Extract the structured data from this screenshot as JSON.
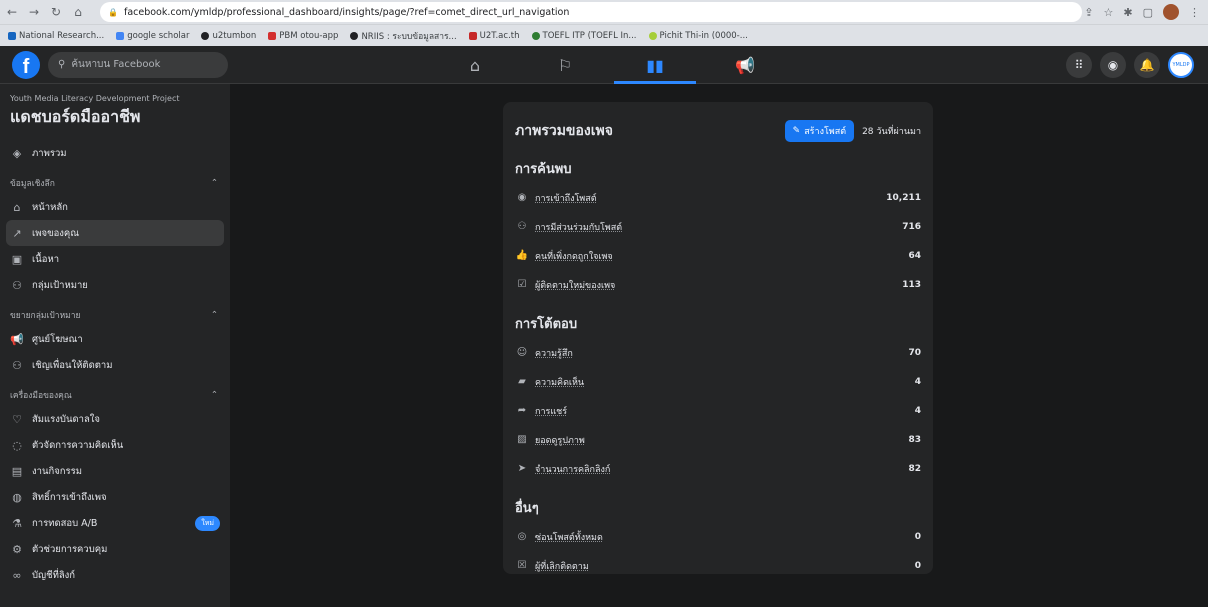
{
  "browser": {
    "url": "facebook.com/ymldp/professional_dashboard/insights/page/?ref=comet_direct_url_navigation",
    "bookmarks": [
      {
        "label": "National Research...",
        "color": "#1565c0"
      },
      {
        "label": "google scholar",
        "color": "#4285f4"
      },
      {
        "label": "u2tumbon",
        "color": "#202124"
      },
      {
        "label": "PBM otou-app",
        "color": "#d32f2f"
      },
      {
        "label": "NRIIS : ระบบข้อมูลสาร...",
        "color": "#202124"
      },
      {
        "label": "U2T.ac.th",
        "color": "#c62828"
      },
      {
        "label": "TOEFL ITP (TOEFL In...",
        "color": "#2e7d32"
      },
      {
        "label": "Pichit Thi-in (0000-...",
        "color": "#a6ce39"
      }
    ]
  },
  "fb": {
    "logo": "f",
    "search_placeholder": "ค้นหาบน Facebook",
    "avatar_text": "YMLDP"
  },
  "sidebar": {
    "project": "Youth Media Literacy Development Project",
    "title": "แดชบอร์ดมืออาชีพ",
    "overview": "ภาพรวม",
    "insights_section": "ข้อมูลเชิงลึก",
    "insights_items": [
      "หน้าหลัก",
      "เพจของคุณ",
      "เนื้อหา",
      "กลุ่มเป้าหมาย"
    ],
    "audience_section": "ขยายกลุ่มเป้าหมาย",
    "audience_items": [
      "ศูนย์โฆษณา",
      "เชิญเพื่อนให้ติดตาม"
    ],
    "tools_section": "เครื่องมือของคุณ",
    "tools_items": [
      "สัมแรงบันดาลใจ",
      "ตัวจัดการความคิดเห็น",
      "งานกิจกรรม",
      "สิทธิ์การเข้าถึงเพจ",
      "การทดสอบ A/B",
      "ตัวช่วยการควบคุม",
      "บัญชีที่ลิงก์"
    ],
    "new_badge": "ใหม่"
  },
  "card": {
    "title": "ภาพรวมของเพจ",
    "create_button": "สร้างโพสต์",
    "period": "28 วันที่ผ่านมา",
    "discovery": {
      "title": "การค้นพบ",
      "rows": [
        {
          "label": "การเข้าถึงโพสต์",
          "value": "10,211"
        },
        {
          "label": "การมีส่วนร่วมกับโพสต์",
          "value": "716"
        },
        {
          "label": "คนที่เพิ่งกดถูกใจเพจ",
          "value": "64"
        },
        {
          "label": "ผู้ติดตามใหม่ของเพจ",
          "value": "113"
        }
      ]
    },
    "interactions": {
      "title": "การโต้ตอบ",
      "rows": [
        {
          "label": "ความรู้สึก",
          "value": "70"
        },
        {
          "label": "ความคิดเห็น",
          "value": "4"
        },
        {
          "label": "การแชร์",
          "value": "4"
        },
        {
          "label": "ยอดดูรูปภาพ",
          "value": "83"
        },
        {
          "label": "จำนวนการคลิกลิงก์",
          "value": "82"
        }
      ]
    },
    "other": {
      "title": "อื่นๆ",
      "rows": [
        {
          "label": "ซ่อนโพสต์ทั้งหมด",
          "value": "0"
        },
        {
          "label": "ผู้ที่เลิกติดตาม",
          "value": "0"
        }
      ]
    }
  }
}
